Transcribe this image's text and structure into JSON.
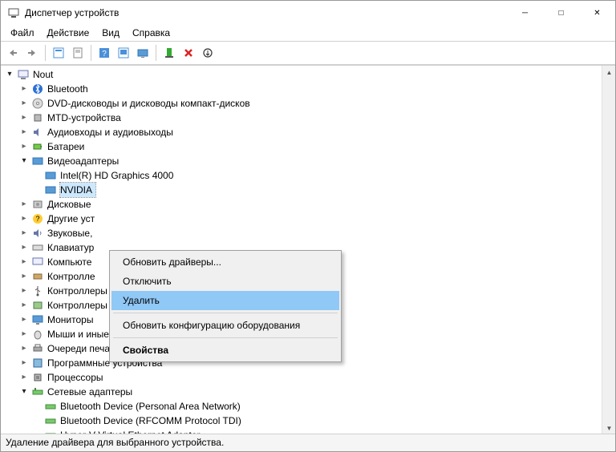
{
  "window": {
    "title": "Диспетчер устройств"
  },
  "menu": {
    "file": "Файл",
    "action": "Действие",
    "view": "Вид",
    "help": "Справка"
  },
  "tree": {
    "root": "Nout",
    "bluetooth": "Bluetooth",
    "dvd": "DVD-дисководы и дисководы компакт-дисков",
    "mtd": "MTD-устройства",
    "audio": "Аудиовходы и аудиовыходы",
    "battery": "Батареи",
    "video": "Видеоадаптеры",
    "video_intel": "Intel(R) HD Graphics 4000",
    "video_nvidia": "NVIDIA",
    "disk": "Дисковые",
    "other": "Другие уст",
    "sound": "Звуковые,",
    "keyboard": "Клавиатур",
    "computer": "Компьюте",
    "controllers_ide": "Контролле",
    "usb": "Контроллеры USB",
    "storage": "Контроллеры запоминающих устройств",
    "monitor": "Мониторы",
    "mouse": "Мыши и иные указывающие устройства",
    "print": "Очереди печати",
    "software": "Программные устройства",
    "cpu": "Процессоры",
    "network": "Сетевые адаптеры",
    "net_bt_pan": "Bluetooth Device (Personal Area Network)",
    "net_bt_rfcomm": "Bluetooth Device (RFCOMM Protocol TDI)",
    "net_hyperv": "Hyper-V Virtual Ethernet Adapter"
  },
  "context": {
    "update": "Обновить драйверы...",
    "disable": "Отключить",
    "delete": "Удалить",
    "scan": "Обновить конфигурацию оборудования",
    "props": "Свойства"
  },
  "status": "Удаление драйвера для выбранного устройства."
}
